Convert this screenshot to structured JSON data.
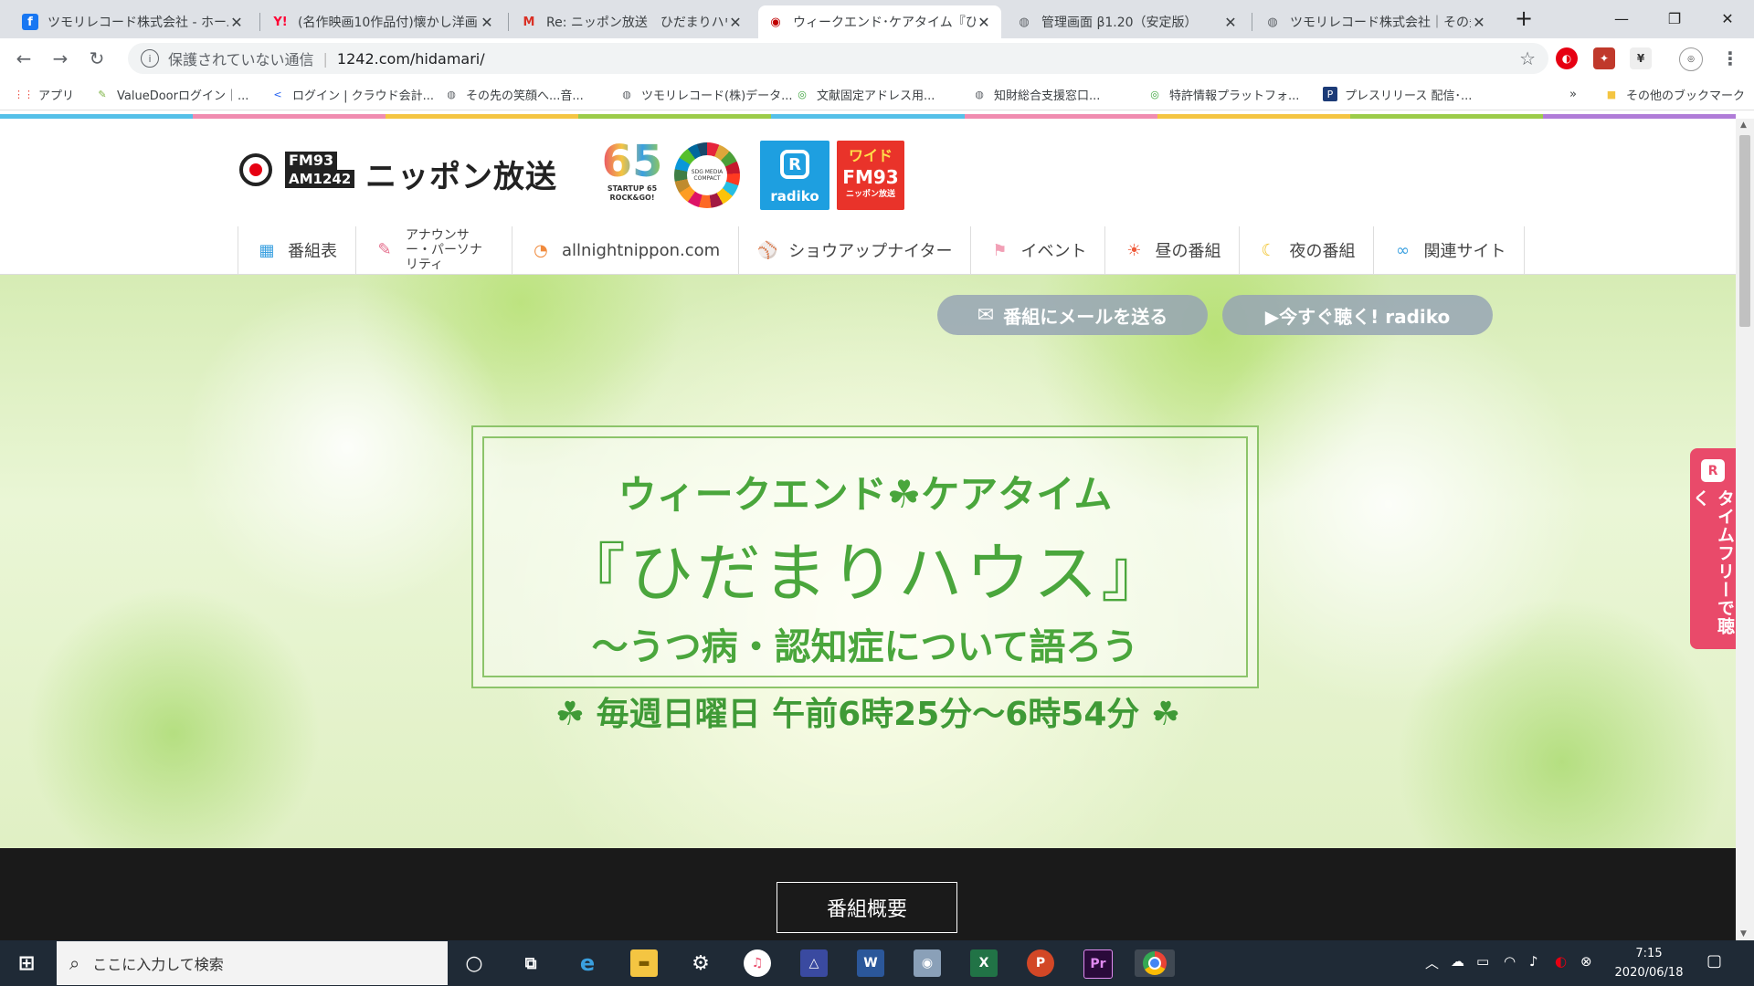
{
  "tabs": [
    {
      "title": "ツモリレコード株式会社 - ホーム",
      "icon": "facebook-icon",
      "icon_text": "f",
      "color": "#1877f2"
    },
    {
      "title": "(名作映画10作品付)懐かし洋画",
      "icon": "yahoo-icon",
      "icon_text": "Y!",
      "color": "#ff0033"
    },
    {
      "title": "Re: ニッポン放送　ひだまりハウス",
      "icon": "gmail-icon",
      "icon_text": "M",
      "color": "#d93025"
    },
    {
      "title": "ウィークエンド･ケアタイム『ひだまり",
      "icon": "nippon-housou-icon",
      "icon_text": "◉",
      "color": "#c00000"
    },
    {
      "title": "管理画面 β1.20（安定版）",
      "icon": "globe-icon",
      "icon_text": "◍",
      "color": "#5f6368"
    },
    {
      "title": "ツモリレコード株式会社｜その先",
      "icon": "globe-icon",
      "icon_text": "◍",
      "color": "#5f6368"
    }
  ],
  "toolbar": {
    "security_label": "保護されていない通信",
    "url": "1242.com/hidamari/"
  },
  "bookmarks": [
    {
      "label": "アプリ",
      "icon": "apps-grid-icon",
      "icon_text": "⋮⋮",
      "color": "#ea4335"
    },
    {
      "label": "ValueDoorログイン｜...",
      "icon": "valuedoor-icon",
      "icon_text": "✎",
      "color": "#7cb342"
    },
    {
      "label": "ログイン | クラウド会計...",
      "icon": "freee-icon",
      "icon_text": "<",
      "color": "#2864f0"
    },
    {
      "label": "その先の笑顔へ...音...",
      "icon": "globe-icon",
      "icon_text": "◍",
      "color": "#5f6368"
    },
    {
      "label": "ツモリレコード(株)データ...",
      "icon": "globe-icon",
      "icon_text": "◍",
      "color": "#5f6368"
    },
    {
      "label": "文献固定アドレス用...",
      "icon": "jplat-icon",
      "icon_text": "◎",
      "color": "#3aa33a"
    },
    {
      "label": "知財総合支援窓口...",
      "icon": "globe-icon",
      "icon_text": "◍",
      "color": "#5f6368"
    },
    {
      "label": "特許情報プラットフォ...",
      "icon": "jplat-icon",
      "icon_text": "◎",
      "color": "#3aa33a"
    },
    {
      "label": "プレスリリース 配信･...",
      "icon": "prtimes-icon",
      "icon_text": "P",
      "color": "#1c3b77"
    }
  ],
  "bookmarks_more": "»",
  "bookmarks_other": "その他のブックマーク",
  "logo": {
    "fm": "FM93",
    "am": "AM1242",
    "name": "ニッポン放送",
    "anniv_number": "65",
    "anniv_caption": "STARTUP 65 ROCK&GO!",
    "sdg_caption": "SDG MEDIA COMPACT",
    "radiko_label": "radiko",
    "wide_line1": "ワイド",
    "wide_line2": "FM93",
    "wide_line3": "ニッポン放送"
  },
  "nav": [
    {
      "label": "番組表",
      "icon": "grid-table-icon",
      "glyph": "▦",
      "color": "#3aa0e0"
    },
    {
      "label": "アナウンサー・パーソナリティ",
      "icon": "microphone-icon",
      "glyph": "✎",
      "color": "#e46b8a"
    },
    {
      "label": "allnightnippon.com",
      "icon": "wifi-icon",
      "glyph": "◔",
      "color": "#f08a3c"
    },
    {
      "label": "ショウアップナイター",
      "icon": "baseball-icon",
      "glyph": "⚾",
      "color": "#b66a2a"
    },
    {
      "label": "イベント",
      "icon": "flag-icon",
      "glyph": "⚑",
      "color": "#f2a0b6"
    },
    {
      "label": "昼の番組",
      "icon": "sun-icon",
      "glyph": "☀",
      "color": "#ee5a3a"
    },
    {
      "label": "夜の番組",
      "icon": "moon-icon",
      "glyph": "☾",
      "color": "#f0c020"
    },
    {
      "label": "関連サイト",
      "icon": "link-icon",
      "glyph": "∞",
      "color": "#3aa0e0"
    }
  ],
  "hero": {
    "mail_button": "番組にメールを送る",
    "radiko_button": "▶今すぐ聴く! radiko",
    "line1": "ウィークエンド☘ケアタイム",
    "line2": "『ひだまりハウス』",
    "line3": "～うつ病・認知症について語ろう",
    "schedule": "☘ 毎週日曜日 午前6時25分～6時54分 ☘"
  },
  "overview_button": "番組概要",
  "side_tab": {
    "icon_text": "R",
    "text": "タイムフリーで聴く"
  },
  "taskbar": {
    "search_placeholder": "ここに入力して検索",
    "clock_time": "7:15",
    "clock_date": "2020/06/18"
  },
  "colors": {
    "hero_green": "#4aa63c",
    "side_tab": "#e94a6a",
    "tab_strip": "#dee1e6"
  }
}
